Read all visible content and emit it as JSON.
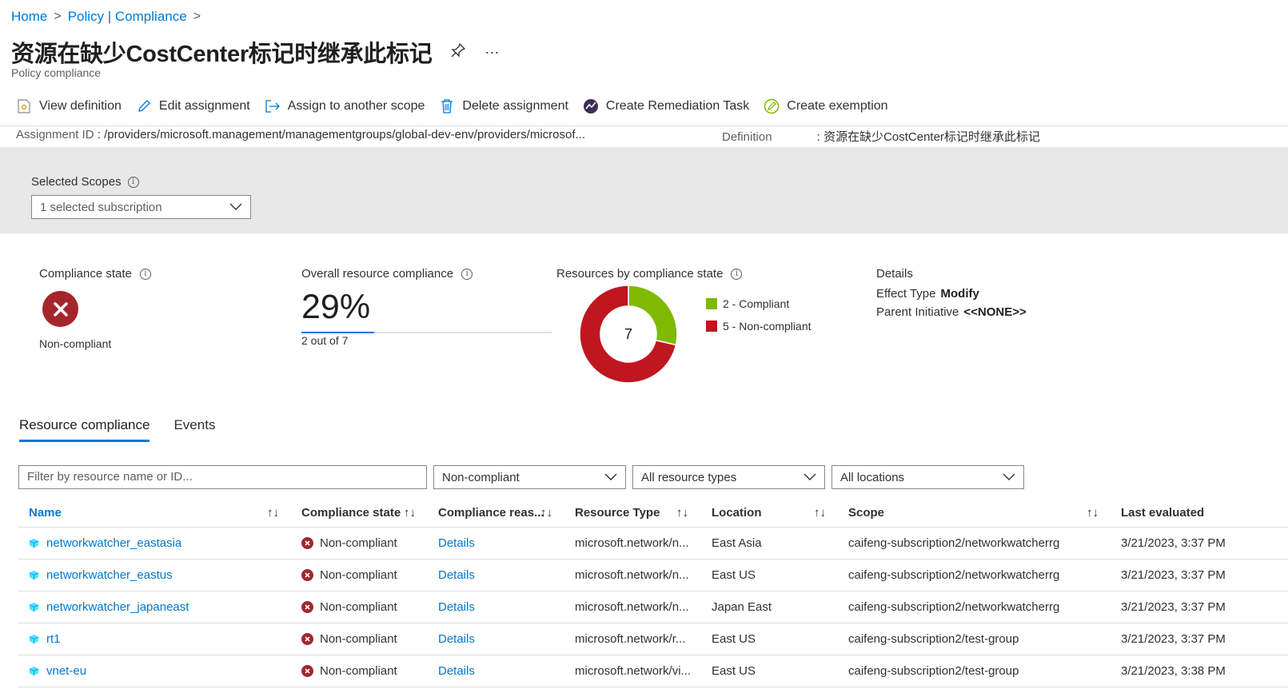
{
  "breadcrumb": {
    "home": "Home",
    "policy": "Policy | Compliance",
    "sep": ">"
  },
  "header": {
    "title": "资源在缺少CostCenter标记时继承此标记",
    "subtitle": "Policy compliance",
    "more": "···"
  },
  "toolbar": {
    "view_definition": "View definition",
    "edit_assignment": "Edit assignment",
    "assign_scope": "Assign to another scope",
    "delete_assignment": "Delete assignment",
    "create_remediation": "Create Remediation Task",
    "create_exemption": "Create exemption"
  },
  "info": {
    "assignment_label": "Assignment ID",
    "assignment_value": "/providers/microsoft.management/managementgroups/global-dev-env/providers/microsof...",
    "definition_label": "Definition",
    "definition_value": "资源在缺少CostCenter标记时继承此标记"
  },
  "scopes": {
    "label": "Selected Scopes",
    "value": "1 selected subscription"
  },
  "summary": {
    "compliance_state_title": "Compliance state",
    "compliance_state_value": "Non-compliant",
    "overall_title": "Overall resource compliance",
    "overall_percent": "29%",
    "overall_sub": "2 out of 7",
    "by_state_title": "Resources by compliance state",
    "total": "7",
    "legend_compliant": "2 - Compliant",
    "legend_noncompliant": "5 - Non-compliant",
    "details_title": "Details",
    "effect_label": "Effect Type",
    "effect_value": "Modify",
    "parent_label": "Parent Initiative",
    "parent_value": "<<NONE>>"
  },
  "donut": {
    "compliant": 2,
    "noncompliant": 5,
    "compliant_color": "#7fba00",
    "noncompliant_color": "#c0161f"
  },
  "tabs": {
    "resource": "Resource compliance",
    "events": "Events"
  },
  "filters": {
    "search_placeholder": "Filter by resource name or ID...",
    "state": "Non-compliant",
    "types": "All resource types",
    "locations": "All locations"
  },
  "table": {
    "headers": {
      "name": "Name",
      "state": "Compliance state",
      "reason": "Compliance reas...",
      "type": "Resource Type",
      "location": "Location",
      "scope": "Scope",
      "evaluated": "Last evaluated"
    },
    "rows": [
      {
        "name": "networkwatcher_eastasia",
        "state": "Non-compliant",
        "reason": "Details",
        "type": "microsoft.network/n...",
        "location": "East Asia",
        "scope": "caifeng-subscription2/networkwatcherrg",
        "evaluated": "3/21/2023, 3:37 PM"
      },
      {
        "name": "networkwatcher_eastus",
        "state": "Non-compliant",
        "reason": "Details",
        "type": "microsoft.network/n...",
        "location": "East US",
        "scope": "caifeng-subscription2/networkwatcherrg",
        "evaluated": "3/21/2023, 3:37 PM"
      },
      {
        "name": "networkwatcher_japaneast",
        "state": "Non-compliant",
        "reason": "Details",
        "type": "microsoft.network/n...",
        "location": "Japan East",
        "scope": "caifeng-subscription2/networkwatcherrg",
        "evaluated": "3/21/2023, 3:37 PM"
      },
      {
        "name": "rt1",
        "state": "Non-compliant",
        "reason": "Details",
        "type": "microsoft.network/r...",
        "location": "East US",
        "scope": "caifeng-subscription2/test-group",
        "evaluated": "3/21/2023, 3:37 PM"
      },
      {
        "name": "vnet-eu",
        "state": "Non-compliant",
        "reason": "Details",
        "type": "microsoft.network/vi...",
        "location": "East US",
        "scope": "caifeng-subscription2/test-group",
        "evaluated": "3/21/2023, 3:38 PM"
      }
    ]
  }
}
